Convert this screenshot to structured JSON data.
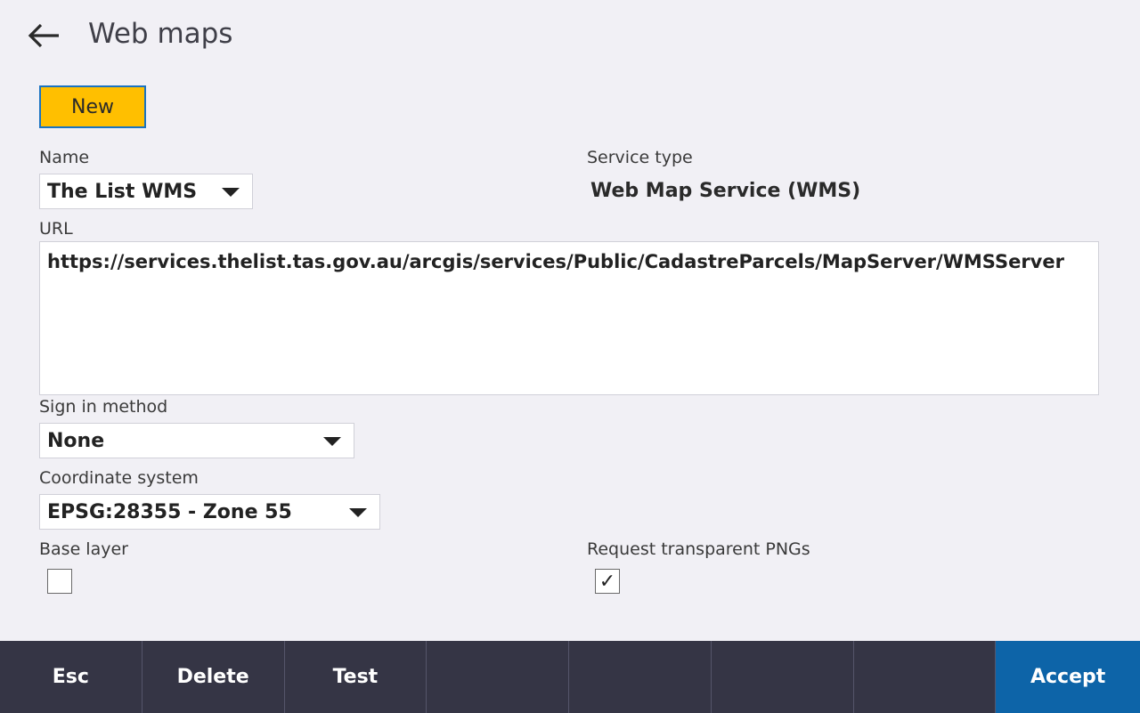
{
  "header": {
    "title": "Web maps"
  },
  "toolbar": {
    "new_label": "New"
  },
  "form": {
    "name": {
      "label": "Name",
      "value": "The List WMS"
    },
    "service_type": {
      "label": "Service type",
      "value": "Web Map Service (WMS)"
    },
    "url": {
      "label": "URL",
      "value": "https://services.thelist.tas.gov.au/arcgis/services/Public/CadastreParcels/MapServer/WMSServer"
    },
    "sign_in": {
      "label": "Sign in method",
      "value": "None"
    },
    "coordinate_system": {
      "label": "Coordinate system",
      "value": "EPSG:28355 - Zone 55"
    },
    "base_layer": {
      "label": "Base layer",
      "checked": false
    },
    "transparent_png": {
      "label": "Request transparent PNGs",
      "checked": true,
      "mark": "✓"
    }
  },
  "footer": {
    "esc": "Esc",
    "delete": "Delete",
    "test": "Test",
    "accept": "Accept"
  },
  "colors": {
    "accent": "#ffbf00",
    "footer_bg": "#353545",
    "accept_bg": "#0d64a8"
  }
}
